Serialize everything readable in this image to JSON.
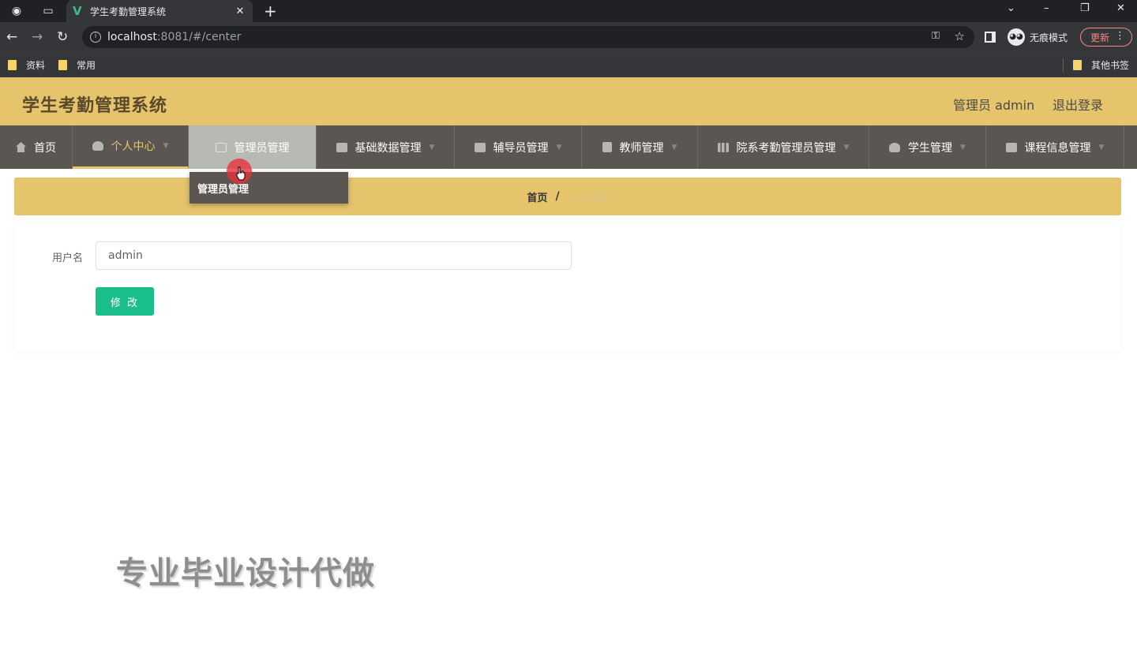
{
  "browser": {
    "tab_title": "学生考勤管理系统",
    "url_host": "localhost",
    "url_rest": ":8081/#/center",
    "incognito_label": "无痕模式",
    "update_label": "更新",
    "bookmarks": [
      "资料",
      "常用"
    ],
    "other_bookmarks": "其他书签"
  },
  "header": {
    "title": "学生考勤管理系统",
    "user_label": "管理员 admin",
    "logout_label": "退出登录"
  },
  "menu": {
    "items": [
      {
        "label": "首页"
      },
      {
        "label": "个人中心"
      },
      {
        "label": "管理员管理"
      },
      {
        "label": "基础数据管理"
      },
      {
        "label": "辅导员管理"
      },
      {
        "label": "教师管理"
      },
      {
        "label": "院系考勤管理员管理"
      },
      {
        "label": "学生管理"
      },
      {
        "label": "课程信息管理"
      }
    ],
    "dropdown_item": "管理员管理"
  },
  "breadcrumb": {
    "home": "首页",
    "separator": "/",
    "current": "个人信息"
  },
  "form": {
    "username_label": "用户名",
    "username_value": "admin",
    "submit_label": "修 改"
  },
  "watermark": "专业毕业设计代做",
  "colors": {
    "accent": "#e5c46c",
    "menu_bg": "#5b5651",
    "button": "#19be8b"
  }
}
